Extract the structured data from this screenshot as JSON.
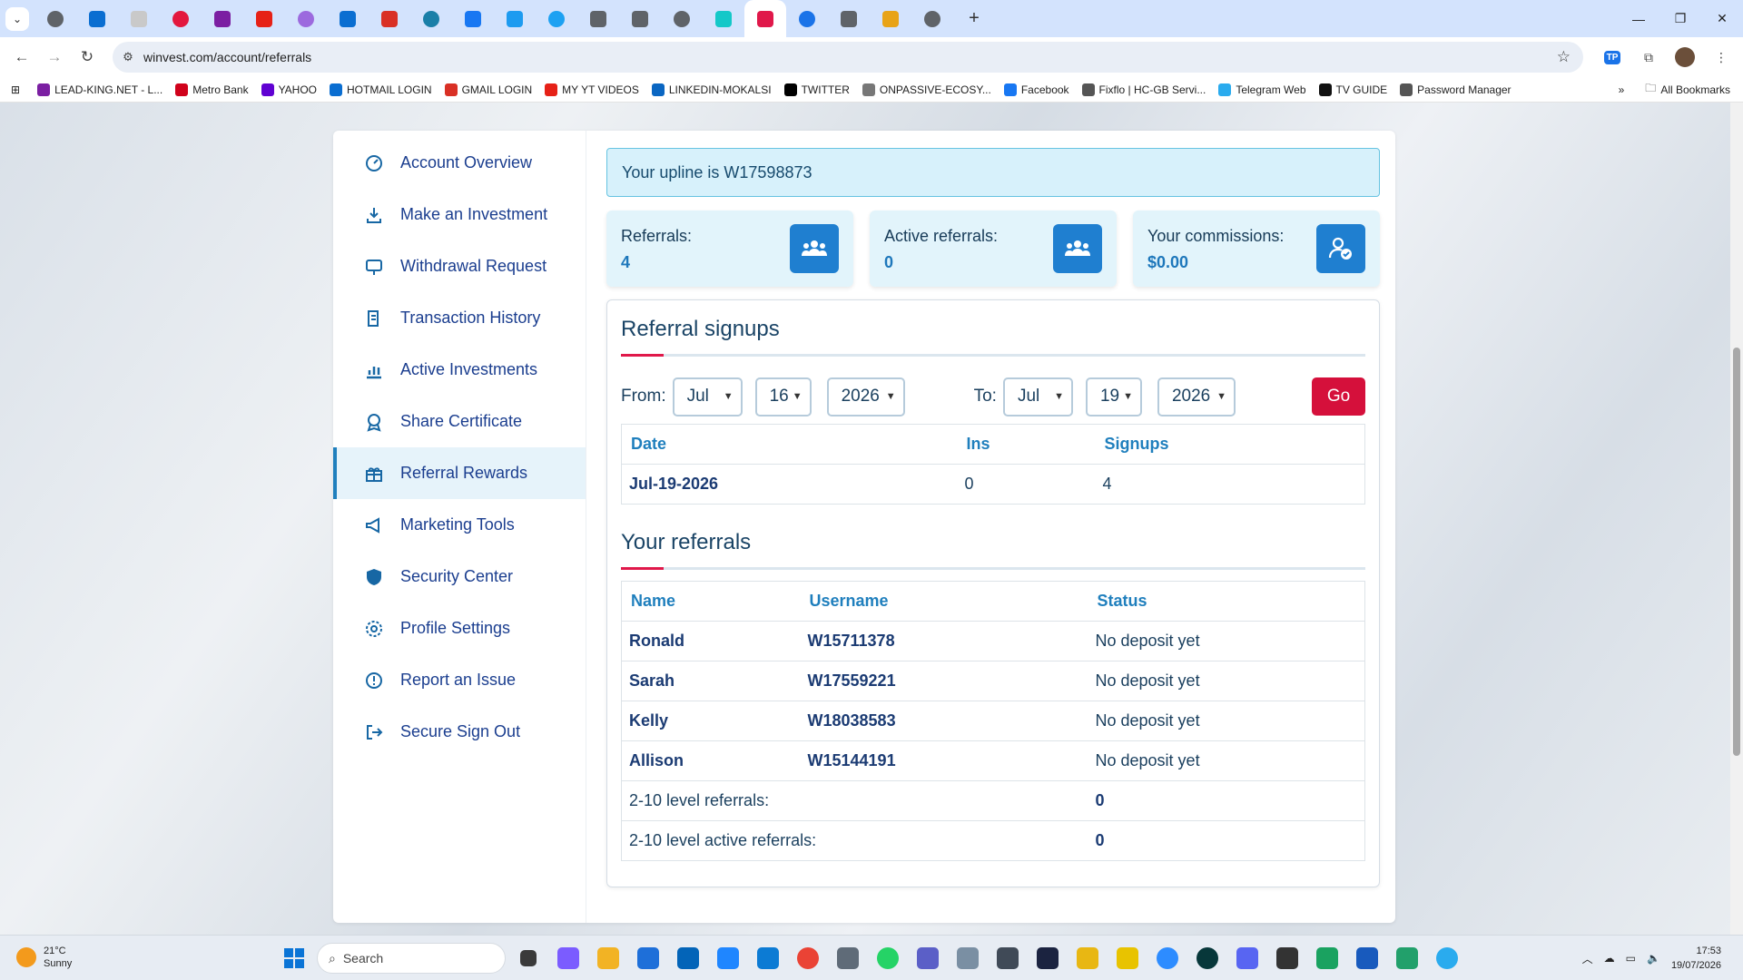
{
  "browser": {
    "url": "winvest.com/account/referrals",
    "tab_icon_colors": [
      "#5f6368",
      "#0a6ed1",
      "#c9c9c9",
      "#e3173e",
      "#7b1fa2",
      "#e62117",
      "#9c6ade",
      "#0a6ed1",
      "#d93025",
      "#1a7fa8",
      "#1877f2",
      "#1d9bf0",
      "#1da1f2",
      "#5f6368",
      "#5f6368",
      "#5f6368",
      "#14c8c8",
      "#e0184a",
      "#1a73e8",
      "#5f6368",
      "#e8a317",
      "#5f6368"
    ]
  },
  "bookmarks": [
    {
      "label": "LEAD-KING.NET - L...",
      "color": "#7b1fa2"
    },
    {
      "label": "Metro Bank",
      "color": "#d0021b"
    },
    {
      "label": "YAHOO",
      "color": "#6001d2"
    },
    {
      "label": "HOTMAIL LOGIN",
      "color": "#0a6ed1"
    },
    {
      "label": "GMAIL LOGIN",
      "color": "#d93025"
    },
    {
      "label": "MY YT VIDEOS",
      "color": "#e62117"
    },
    {
      "label": "LINKEDIN-MOKALSI",
      "color": "#0a66c2"
    },
    {
      "label": "TWITTER",
      "color": "#000000"
    },
    {
      "label": "ONPASSIVE-ECOSY...",
      "color": "#777777"
    },
    {
      "label": "Facebook",
      "color": "#1877f2"
    },
    {
      "label": "Fixflo | HC-GB Servi...",
      "color": "#555555"
    },
    {
      "label": "Telegram Web",
      "color": "#2aabee"
    },
    {
      "label": "TV GUIDE",
      "color": "#111111"
    },
    {
      "label": "Password Manager",
      "color": "#555555"
    }
  ],
  "bookmarks_all": "All Bookmarks",
  "sidebar": {
    "items": [
      {
        "label": "Account Overview",
        "icon": "gauge-icon"
      },
      {
        "label": "Make an Investment",
        "icon": "download-icon"
      },
      {
        "label": "Withdrawal Request",
        "icon": "withdraw-icon"
      },
      {
        "label": "Transaction History",
        "icon": "receipt-icon"
      },
      {
        "label": "Active Investments",
        "icon": "chart-icon"
      },
      {
        "label": "Share Certificate",
        "icon": "award-icon"
      },
      {
        "label": "Referral Rewards",
        "icon": "gift-icon",
        "active": true
      },
      {
        "label": "Marketing Tools",
        "icon": "megaphone-icon"
      },
      {
        "label": "Security Center",
        "icon": "shield-icon"
      },
      {
        "label": "Profile Settings",
        "icon": "gear-icon"
      },
      {
        "label": "Report an Issue",
        "icon": "alert-icon"
      },
      {
        "label": "Secure Sign Out",
        "icon": "signout-icon"
      }
    ]
  },
  "upline": "Your upline is W17598873",
  "stats": [
    {
      "label": "Referrals:",
      "value": "4"
    },
    {
      "label": "Active referrals:",
      "value": "0"
    },
    {
      "label": "Your commissions:",
      "value": "$0.00"
    }
  ],
  "signups": {
    "title": "Referral signups",
    "from_label": "From:",
    "to_label": "To:",
    "from": {
      "month": "Jul",
      "day": "16",
      "year": "2026"
    },
    "to": {
      "month": "Jul",
      "day": "19",
      "year": "2026"
    },
    "go_label": "Go",
    "headers": [
      "Date",
      "Ins",
      "Signups"
    ],
    "rows": [
      [
        "Jul-19-2026",
        "0",
        "4"
      ]
    ]
  },
  "referrals": {
    "title": "Your referrals",
    "headers": [
      "Name",
      "Username",
      "Status"
    ],
    "rows": [
      [
        "Ronald",
        "W15711378",
        "No deposit yet"
      ],
      [
        "Sarah",
        "W17559221",
        "No deposit yet"
      ],
      [
        "Kelly",
        "W18038583",
        "No deposit yet"
      ],
      [
        "Allison",
        "W15144191",
        "No deposit yet"
      ]
    ],
    "level_rows": [
      {
        "label": "2-10 level referrals:",
        "value": "0"
      },
      {
        "label": "2-10 level active referrals:",
        "value": "0"
      }
    ]
  },
  "taskbar": {
    "weather_temp": "21°C",
    "weather_desc": "Sunny",
    "search_placeholder": "Search",
    "time": "17:53",
    "date": "19/07/2026"
  }
}
